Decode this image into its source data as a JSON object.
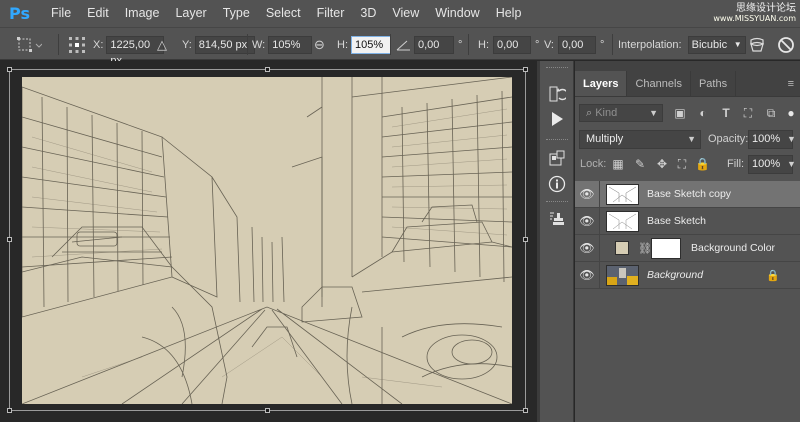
{
  "app": {
    "logo": "Ps"
  },
  "menu": [
    "File",
    "Edit",
    "Image",
    "Layer",
    "Type",
    "Select",
    "Filter",
    "3D",
    "View",
    "Window",
    "Help"
  ],
  "watermark": {
    "line1": "思缘设计论坛",
    "line2": "www.MISSYUAN.com"
  },
  "options": {
    "x_label": "X:",
    "x_value": "1225,00 px",
    "y_label": "Y:",
    "y_value": "814,50 px",
    "w_label": "W:",
    "w_value": "105%",
    "h_label": "H:",
    "h_value": "105%",
    "angle_value": "0,00",
    "hskew_label": "H:",
    "hskew_value": "0,00",
    "vskew_label": "V:",
    "vskew_value": "0,00",
    "degree_symbol": "°",
    "interp_label": "Interpolation:",
    "interp_value": "Bicubic"
  },
  "panel": {
    "tabs": [
      "Layers",
      "Channels",
      "Paths"
    ],
    "kind_placeholder": "Kind",
    "blend_mode": "Multiply",
    "opacity_label": "Opacity:",
    "opacity_value": "100%",
    "lock_label": "Lock:",
    "fill_label": "Fill:",
    "fill_value": "100%"
  },
  "layers": [
    {
      "name": "Base Sketch copy",
      "selected": true,
      "italic": false,
      "locked": false
    },
    {
      "name": "Base Sketch",
      "selected": false,
      "italic": false,
      "locked": false
    },
    {
      "name": "Background Color",
      "selected": false,
      "italic": false,
      "locked": false,
      "fill_color": "#d6cdb4"
    },
    {
      "name": "Background",
      "selected": false,
      "italic": true,
      "locked": true
    }
  ],
  "colors": {
    "accent": "#31a8ff",
    "canvas": "#d6cdb4",
    "panel_bg": "#535353"
  }
}
